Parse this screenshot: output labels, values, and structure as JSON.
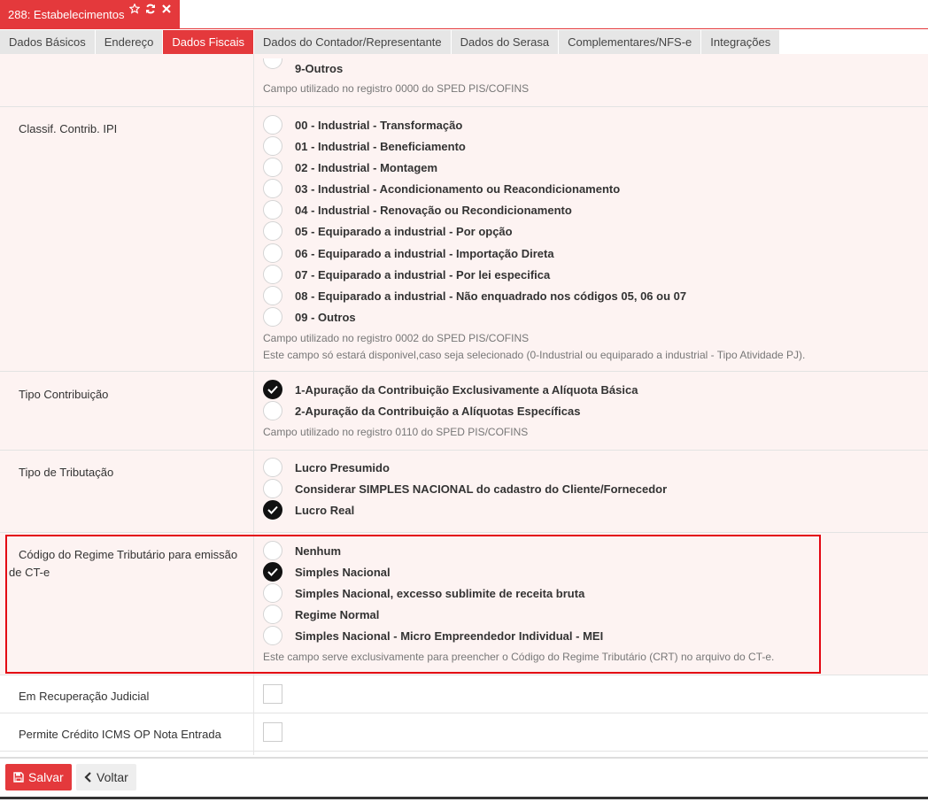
{
  "window": {
    "title": "288: Estabelecimentos"
  },
  "tabs": [
    {
      "label": "Dados Básicos",
      "active": false
    },
    {
      "label": "Endereço",
      "active": false
    },
    {
      "label": "Dados Fiscais",
      "active": true
    },
    {
      "label": "Dados do Contador/Representante",
      "active": false
    },
    {
      "label": "Dados do Serasa",
      "active": false
    },
    {
      "label": "Complementares/NFS-e",
      "active": false
    },
    {
      "label": "Integrações",
      "active": false
    }
  ],
  "sections": {
    "top": {
      "options": [
        {
          "label": "9-Outros",
          "checked": false
        }
      ],
      "help": [
        "Campo utilizado no registro 0000 do SPED PIS/COFINS"
      ]
    },
    "ipi": {
      "label": "Classif. Contrib. IPI",
      "options": [
        {
          "label": "00 - Industrial - Transformação",
          "checked": false
        },
        {
          "label": "01 - Industrial - Beneficiamento",
          "checked": false
        },
        {
          "label": "02 - Industrial - Montagem",
          "checked": false
        },
        {
          "label": "03 - Industrial - Acondicionamento ou Reacondicionamento",
          "checked": false
        },
        {
          "label": "04 - Industrial - Renovação ou Recondicionamento",
          "checked": false
        },
        {
          "label": "05 - Equiparado a industrial - Por opção",
          "checked": false
        },
        {
          "label": "06 - Equiparado a industrial - Importação Direta",
          "checked": false
        },
        {
          "label": "07 - Equiparado a industrial - Por lei especifica",
          "checked": false
        },
        {
          "label": "08 - Equiparado a industrial - Não enquadrado nos códigos 05, 06 ou 07",
          "checked": false
        },
        {
          "label": "09 - Outros",
          "checked": false
        }
      ],
      "help": [
        "Campo utilizado no registro 0002 do SPED PIS/COFINS",
        "Este campo só estará disponivel,caso seja selecionado (0-Industrial ou equiparado a industrial - Tipo Atividade PJ)."
      ]
    },
    "contribuicao": {
      "label": "Tipo Contribuição",
      "options": [
        {
          "label": "1-Apuração da Contribuição Exclusivamente a Alíquota Básica",
          "checked": true
        },
        {
          "label": "2-Apuração da Contribuição a Alíquotas Específicas",
          "checked": false
        }
      ],
      "help": [
        "Campo utilizado no registro 0110 do SPED PIS/COFINS"
      ]
    },
    "tributacao": {
      "label": "Tipo de Tributação",
      "options": [
        {
          "label": "Lucro Presumido",
          "checked": false
        },
        {
          "label": "Considerar SIMPLES NACIONAL do cadastro do Cliente/Fornecedor",
          "checked": false
        },
        {
          "label": "Lucro Real",
          "checked": true
        }
      ]
    },
    "crt": {
      "label_line1": "Código do Regime Tributário para emissão",
      "label_line2": "de CT-e",
      "options": [
        {
          "label": "Nenhum",
          "checked": false
        },
        {
          "label": "Simples Nacional",
          "checked": true
        },
        {
          "label": "Simples Nacional, excesso sublimite de receita bruta",
          "checked": false
        },
        {
          "label": "Regime Normal",
          "checked": false
        },
        {
          "label": "Simples Nacional - Micro Empreendedor Individual - MEI",
          "checked": false
        }
      ],
      "help": [
        "Este campo serve exclusivamente para preencher o Código do Regime Tributário (CRT) no arquivo do CT-e."
      ]
    },
    "recuperacao": {
      "label": "Em Recuperação Judicial",
      "checked": false
    },
    "credito": {
      "label": "Permite Crédito ICMS OP Nota Entrada",
      "checked": false
    }
  },
  "footer": {
    "save_label": "Salvar",
    "back_label": "Voltar"
  },
  "colors": {
    "accent": "#e4393c",
    "highlight": "#e30613"
  }
}
